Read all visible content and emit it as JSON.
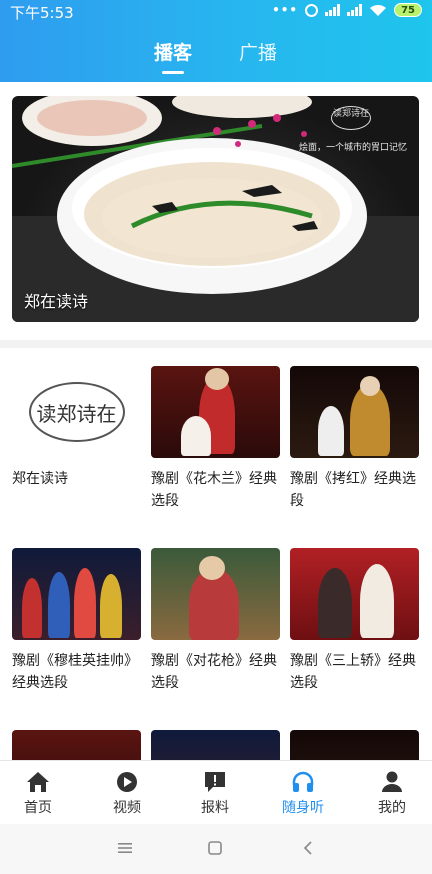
{
  "status": {
    "time": "下午5:53",
    "battery": "75",
    "icons": [
      "more-dots-icon",
      "alarm-icon",
      "signal-icon",
      "signal-icon",
      "wifi-icon",
      "battery-icon"
    ]
  },
  "tabs": [
    {
      "label": "播客",
      "active": true
    },
    {
      "label": "广播",
      "active": false
    }
  ],
  "banner": {
    "label": "郑在读诗",
    "brand_text": "读郑诗在",
    "slogan": "烩面，一个城市的胃口记忆"
  },
  "grid": [
    {
      "caption": "郑在读诗",
      "thumb": "logo",
      "logo_text": "读郑诗在"
    },
    {
      "caption": "豫剧《花木兰》经典选段",
      "thumb": "opera"
    },
    {
      "caption": "豫剧《拷红》经典选段",
      "thumb": "opera"
    },
    {
      "caption": "豫剧《穆桂英挂帅》经典选段",
      "thumb": "opera"
    },
    {
      "caption": "豫剧《对花枪》经典选段",
      "thumb": "opera"
    },
    {
      "caption": "豫剧《三上轿》经典选段",
      "thumb": "opera"
    }
  ],
  "navbar": [
    {
      "label": "首页",
      "icon": "home-icon",
      "active": false
    },
    {
      "label": "视频",
      "icon": "play-icon",
      "active": false
    },
    {
      "label": "报料",
      "icon": "report-icon",
      "active": false
    },
    {
      "label": "随身听",
      "icon": "headphones-icon",
      "active": true
    },
    {
      "label": "我的",
      "icon": "user-icon",
      "active": false
    }
  ],
  "colors": {
    "header_start": "#2f9cef",
    "header_end": "#1ec5ec",
    "active_nav": "#1f8ff0"
  }
}
